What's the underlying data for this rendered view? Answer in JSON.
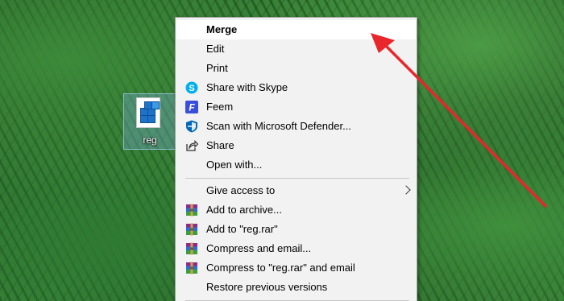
{
  "desktop": {
    "file_icon_label": "reg"
  },
  "context_menu": {
    "items": [
      {
        "label": "Merge",
        "bold": true,
        "icon": null
      },
      {
        "label": "Edit",
        "icon": null
      },
      {
        "label": "Print",
        "icon": null
      },
      {
        "label": "Share with Skype",
        "icon": "skype-icon"
      },
      {
        "label": "Feem",
        "icon": "feem-icon"
      },
      {
        "label": "Scan with Microsoft Defender...",
        "icon": "defender-shield-icon"
      },
      {
        "label": "Share",
        "icon": "share-icon"
      },
      {
        "label": "Open with...",
        "icon": null
      },
      {
        "label": "Give access to",
        "icon": null,
        "submenu": true
      },
      {
        "label": "Add to archive...",
        "icon": "winrar-icon"
      },
      {
        "label": "Add to \"reg.rar\"",
        "icon": "winrar-icon"
      },
      {
        "label": "Compress and email...",
        "icon": "winrar-icon"
      },
      {
        "label": "Compress to \"reg.rar\" and email",
        "icon": "winrar-icon"
      },
      {
        "label": "Restore previous versions",
        "icon": null
      }
    ]
  },
  "colors": {
    "annotation_arrow": "#e8262b",
    "menu_background": "#f2f2f2",
    "skype_blue": "#00aff0",
    "feem_blue": "#3a4fd9",
    "defender_blue": "#0067b8"
  }
}
